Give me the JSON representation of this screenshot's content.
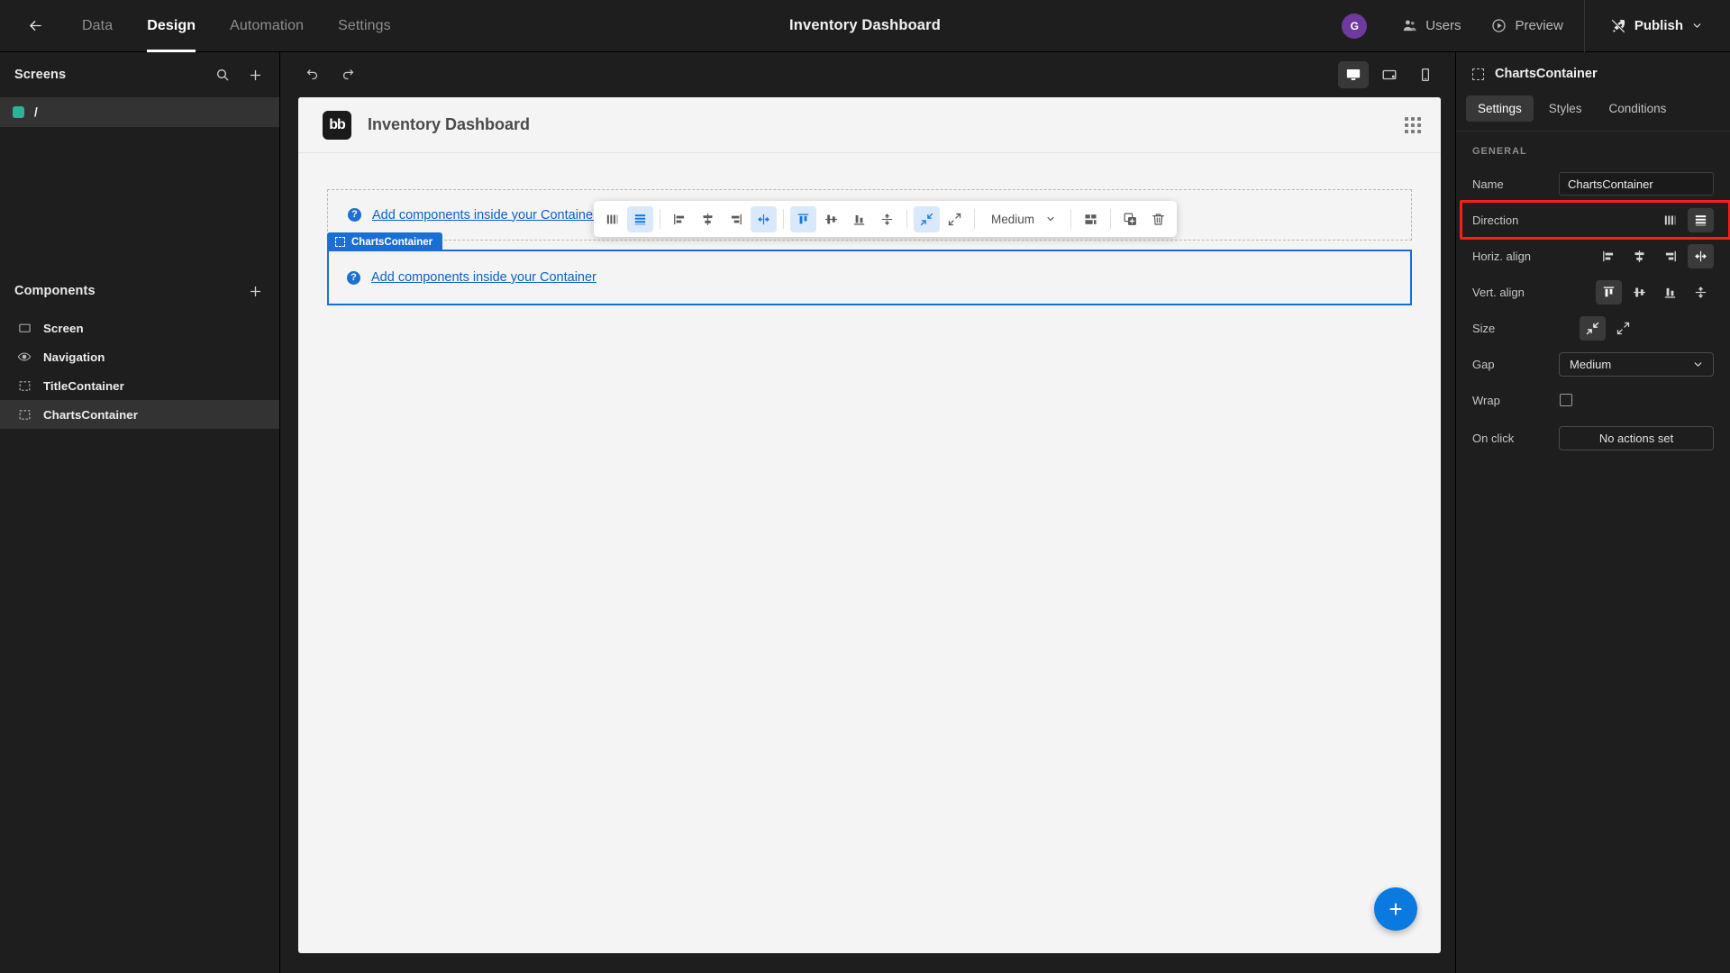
{
  "topbar": {
    "back_icon": "arrow-left-icon",
    "tabs": [
      {
        "label": "Data",
        "active": false
      },
      {
        "label": "Design",
        "active": true
      },
      {
        "label": "Automation",
        "active": false
      },
      {
        "label": "Settings",
        "active": false
      }
    ],
    "title": "Inventory Dashboard",
    "avatar_initial": "G",
    "users_label": "Users",
    "preview_label": "Preview",
    "publish_label": "Publish"
  },
  "sidebar": {
    "screens": {
      "title": "Screens",
      "search_icon": "search-icon",
      "add_icon": "plus-icon",
      "items": [
        {
          "label": "/",
          "selected": true
        }
      ]
    },
    "components": {
      "title": "Components",
      "add_icon": "plus-icon",
      "items": [
        {
          "label": "Screen",
          "icon": "screen-icon",
          "selected": false
        },
        {
          "label": "Navigation",
          "icon": "eye-icon",
          "selected": false
        },
        {
          "label": "TitleContainer",
          "icon": "container-icon",
          "selected": false
        },
        {
          "label": "ChartsContainer",
          "icon": "container-icon",
          "selected": true
        }
      ]
    }
  },
  "canvas_toolbar": {
    "undo_icon": "undo-icon",
    "redo_icon": "redo-icon",
    "devices": [
      {
        "name": "desktop",
        "active": true
      },
      {
        "name": "tablet",
        "active": false
      },
      {
        "name": "mobile",
        "active": false
      }
    ]
  },
  "canvas": {
    "logo_text": "bb",
    "title": "Inventory Dashboard",
    "grid_icon": "grid-icon",
    "title_container": {
      "placeholder_link": "Add components inside your Container",
      "help_icon": "question-icon"
    },
    "charts_container": {
      "tag_label": "ChartsContainer",
      "placeholder_link": "Add components inside your Container",
      "help_icon": "question-icon"
    },
    "fab_icon": "plus-icon"
  },
  "format_toolbar": {
    "direction": [
      {
        "name": "direction-horizontal",
        "active": false
      },
      {
        "name": "direction-vertical",
        "active": true
      }
    ],
    "horiz_align": [
      {
        "name": "align-left",
        "active": false
      },
      {
        "name": "align-center",
        "active": false
      },
      {
        "name": "align-right",
        "active": false
      },
      {
        "name": "align-stretch",
        "active": true
      }
    ],
    "vert_align": [
      {
        "name": "valign-top",
        "active": true
      },
      {
        "name": "valign-middle",
        "active": false
      },
      {
        "name": "valign-bottom",
        "active": false
      },
      {
        "name": "valign-stretch",
        "active": false
      }
    ],
    "size": [
      {
        "name": "size-shrink",
        "active": true
      },
      {
        "name": "size-grow",
        "active": false
      }
    ],
    "gap_value": "Medium",
    "layout_icon": "layout-icon",
    "duplicate_icon": "duplicate-icon",
    "delete_icon": "trash-icon"
  },
  "right_panel": {
    "header_title": "ChartsContainer",
    "tabs": [
      {
        "label": "Settings",
        "active": true
      },
      {
        "label": "Styles",
        "active": false
      },
      {
        "label": "Conditions",
        "active": false
      }
    ],
    "group_title": "GENERAL",
    "fields": {
      "name_label": "Name",
      "name_value": "ChartsContainer",
      "direction_label": "Direction",
      "horiz_align_label": "Horiz. align",
      "vert_align_label": "Vert. align",
      "size_label": "Size",
      "gap_label": "Gap",
      "gap_value": "Medium",
      "wrap_label": "Wrap",
      "wrap_checked": false,
      "onclick_label": "On click",
      "onclick_value": "No actions set"
    },
    "highlight_color": "#fd1d1d"
  },
  "colors": {
    "app_bg": "#1e1e1e",
    "canvas_bg": "#f4f4f4",
    "accent_blue": "#1b6fd4",
    "avatar_purple": "#6e3a9e",
    "screen_dot_green": "#2bb39a",
    "highlight_red": "#fd1d1d"
  }
}
